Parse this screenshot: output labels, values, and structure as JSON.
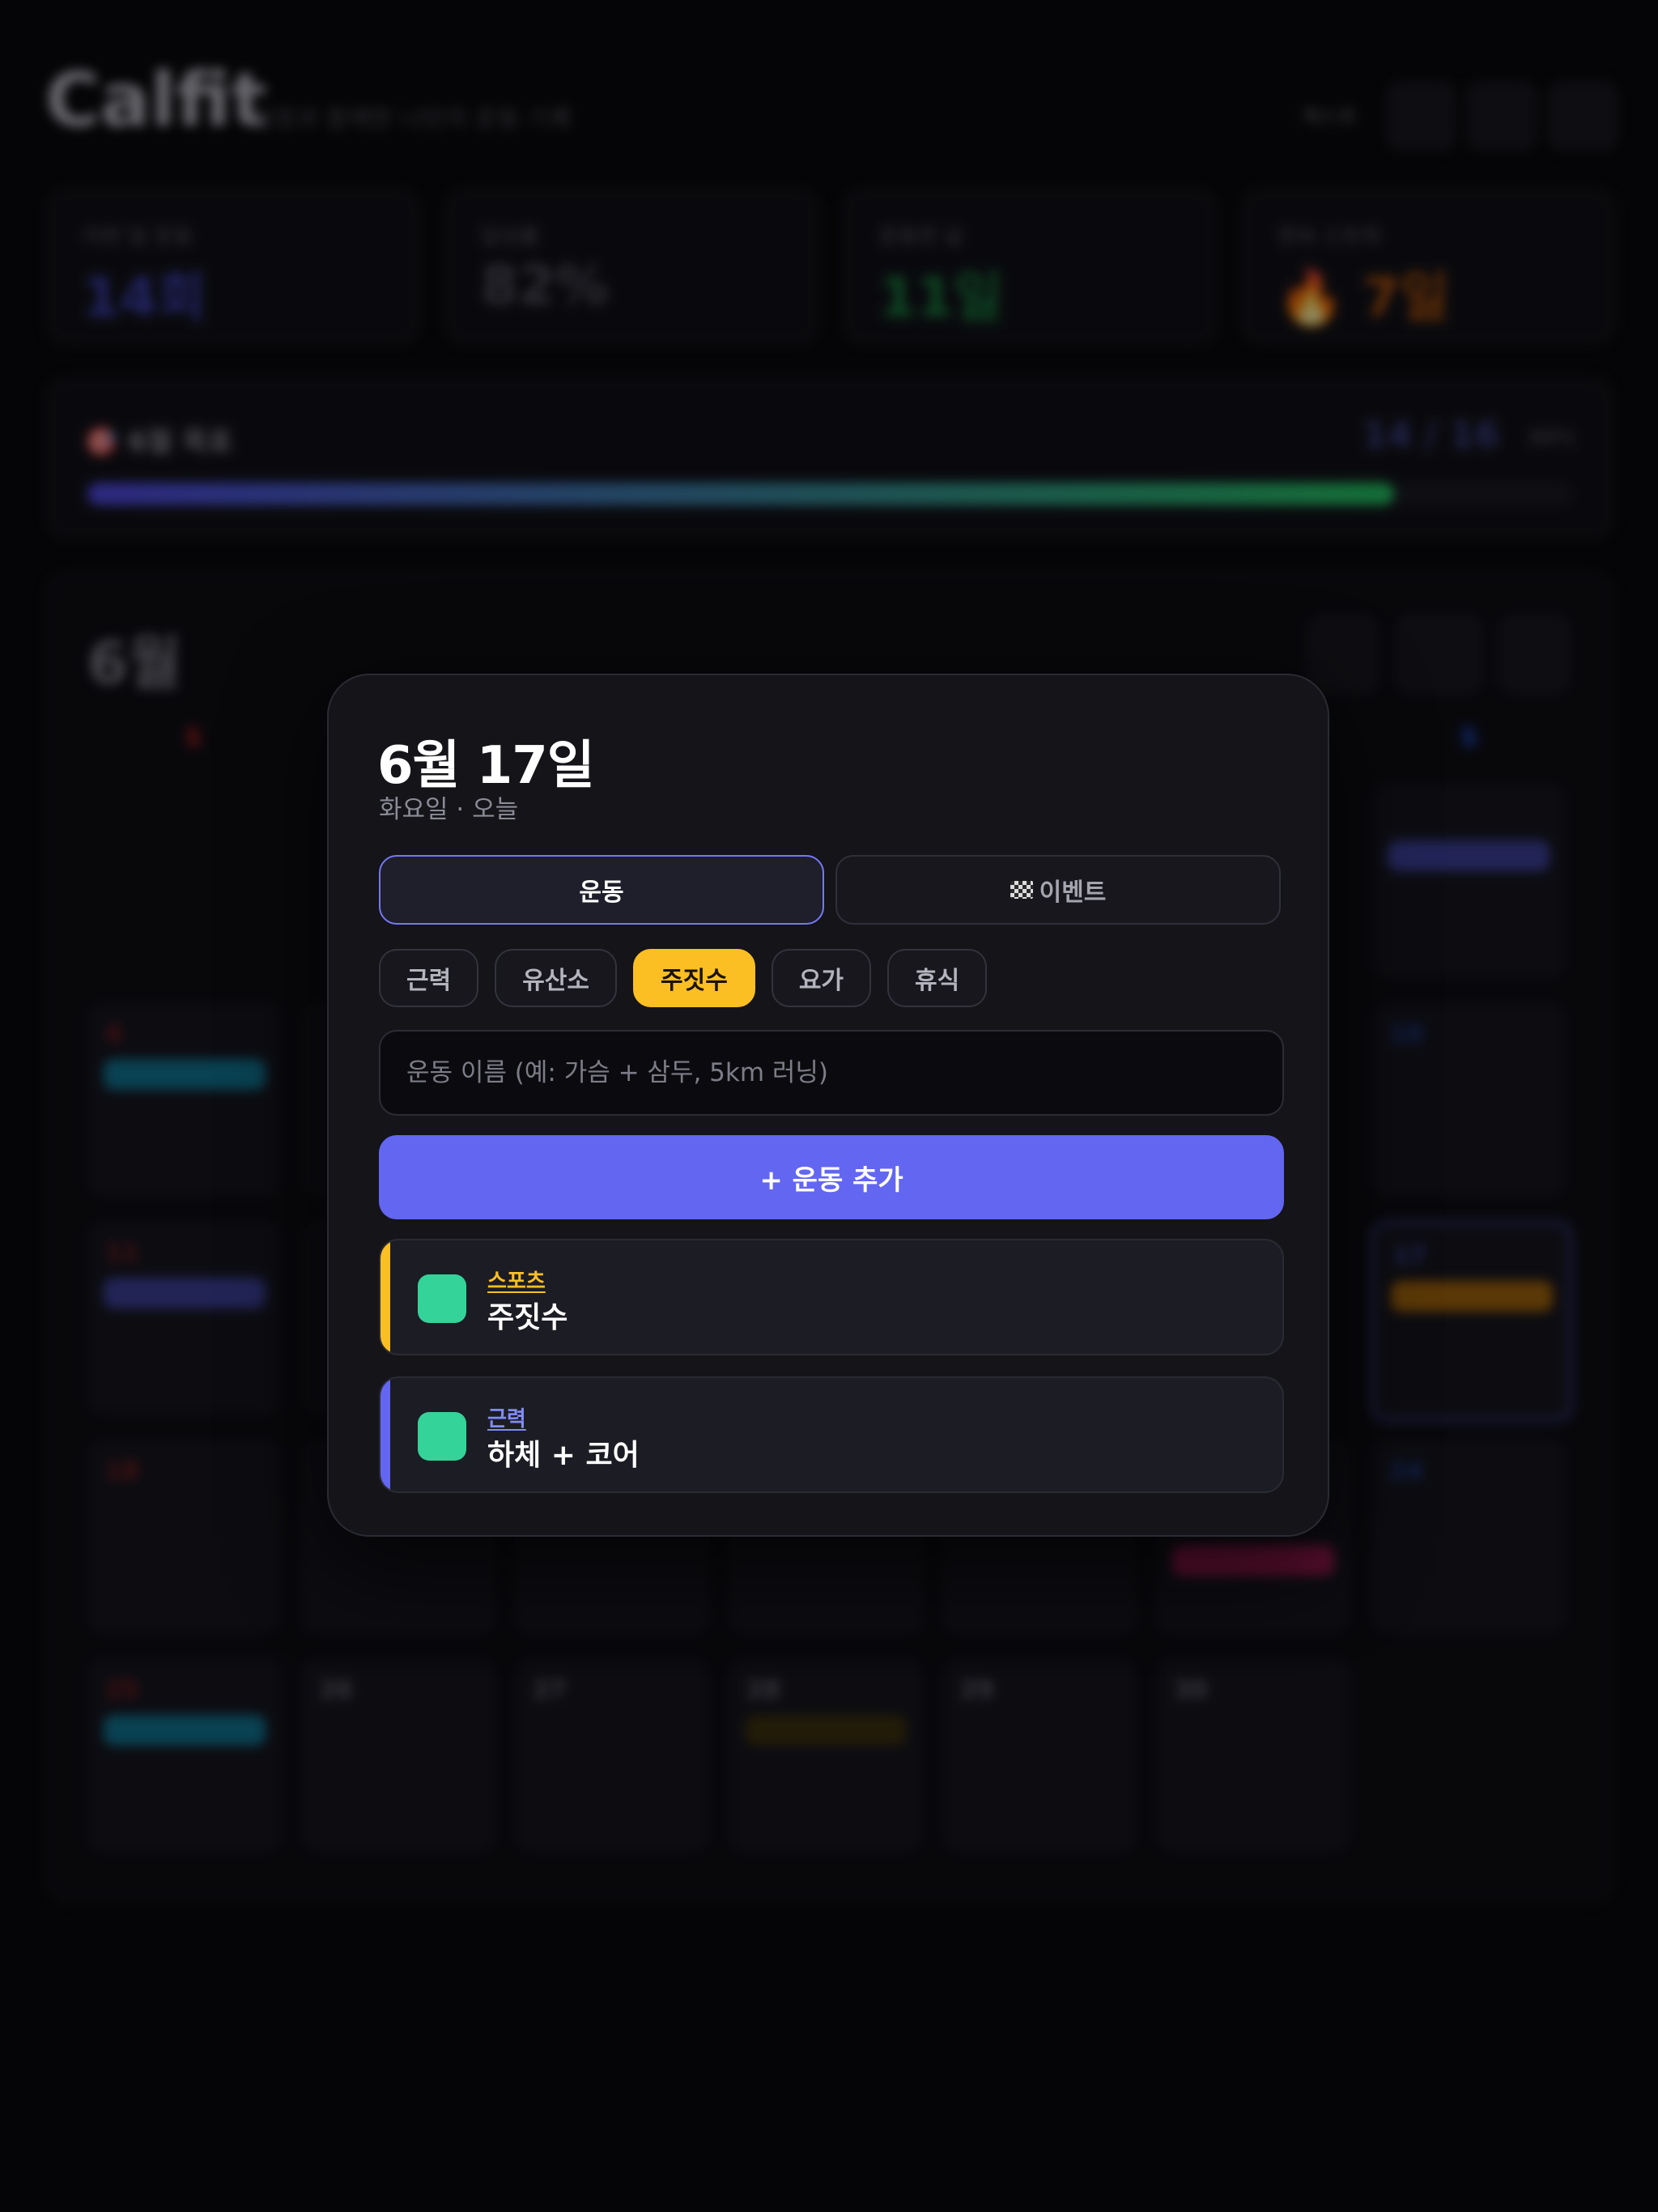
{
  "app": {
    "brand": "Calfit",
    "tagline": "일정과 함께한 나만의 운동 기록",
    "header_text": "게스트"
  },
  "stats": [
    {
      "label": "이번 달 운동",
      "value": "14회",
      "color": "#4f46e5"
    },
    {
      "label": "달성률",
      "value": "82%",
      "color": "#4a4a55"
    },
    {
      "label": "운동한 날",
      "value": "11일",
      "color": "#16a34a"
    },
    {
      "label": "연속 스트릭",
      "value": "🔥 7일",
      "color": "#d97706"
    }
  ],
  "goal": {
    "title": "🎯 6월 목표",
    "count": "14 / 16",
    "percent": "88%",
    "progress": 0.88
  },
  "calendar": {
    "month": "6월",
    "today_button": "오늘",
    "weekday_sun": "S",
    "weekday_sat": "S",
    "days": [
      "4",
      "10",
      "11",
      "17",
      "18",
      "24",
      "25",
      "26",
      "27",
      "28",
      "29",
      "30"
    ]
  },
  "modal": {
    "date_title": "6월 17일",
    "subtitle": "화요일 · 오늘",
    "tabs": {
      "workout": "운동",
      "event": "이벤트"
    },
    "categories": [
      "근력",
      "유산소",
      "주짓수",
      "요가",
      "휴식"
    ],
    "selected_category": "주짓수",
    "input_placeholder": "운동 이름 (예: 가슴 + 삼두, 5km 러닝)",
    "add_button": "+ 운동 추가",
    "entries": [
      {
        "category": "스포츠",
        "name": "주짓수",
        "color": "#fbbf24"
      },
      {
        "category": "근력",
        "name": "하체 + 코어",
        "color": "#6366f1"
      }
    ]
  }
}
